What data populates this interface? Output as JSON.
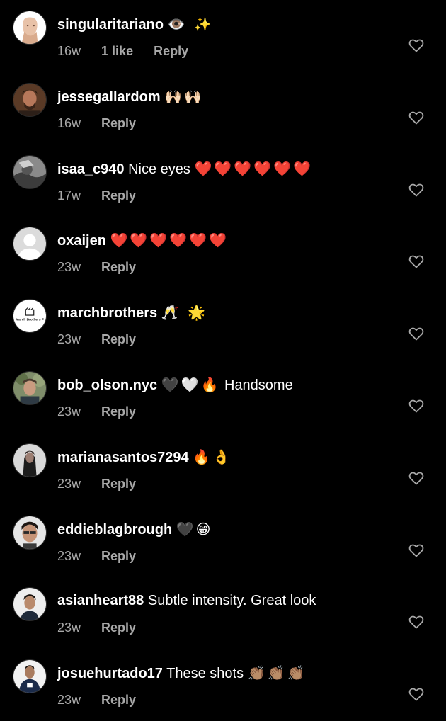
{
  "colors": {
    "background": "#000000",
    "text": "#ffffff",
    "muted": "#a8a8a8",
    "heart_red": "#ef3340"
  },
  "comments": [
    {
      "username": "singularitariano",
      "text": "",
      "emoji": "👁️ ✨",
      "time": "16w",
      "likes": "1 like",
      "reply": "Reply",
      "avatar": "cartoon-face-avatar"
    },
    {
      "username": "jessegallardom",
      "text": "",
      "emoji": "🙌🏻🙌🏻",
      "time": "16w",
      "likes": "",
      "reply": "Reply",
      "avatar": "photo-avatar"
    },
    {
      "username": "isaa_c940",
      "text": "Nice eyes",
      "emoji": "❤️❤️❤️❤️❤️❤️",
      "time": "17w",
      "likes": "",
      "reply": "Reply",
      "avatar": "photo-avatar"
    },
    {
      "username": "oxaijen",
      "text": "",
      "emoji": "❤️❤️❤️❤️❤️❤️",
      "time": "23w",
      "likes": "",
      "reply": "Reply",
      "avatar": "default-avatar"
    },
    {
      "username": "marchbrothers",
      "text": "",
      "emoji": "🥂 🌟",
      "time": "23w",
      "likes": "",
      "reply": "Reply",
      "avatar": "logo-avatar",
      "avatar_text": "March Brothers F"
    },
    {
      "username": "bob_olson.nyc",
      "text": "Handsome",
      "emoji": "🖤🤍🔥",
      "time": "23w",
      "likes": "",
      "reply": "Reply",
      "avatar": "photo-avatar"
    },
    {
      "username": "marianasantos7294",
      "text": "",
      "emoji": "🔥👌",
      "time": "23w",
      "likes": "",
      "reply": "Reply",
      "avatar": "photo-avatar"
    },
    {
      "username": "eddieblagbrough",
      "text": "",
      "emoji": "🖤😁",
      "time": "23w",
      "likes": "",
      "reply": "Reply",
      "avatar": "photo-avatar"
    },
    {
      "username": "asianheart88",
      "text": "Subtle intensity.  Great look",
      "emoji": "",
      "time": "23w",
      "likes": "",
      "reply": "Reply",
      "avatar": "photo-avatar"
    },
    {
      "username": "josuehurtado17",
      "text": "These shots",
      "emoji": "👏🏽👏🏽👏🏽",
      "time": "23w",
      "likes": "",
      "reply": "Reply",
      "avatar": "photo-avatar"
    }
  ]
}
